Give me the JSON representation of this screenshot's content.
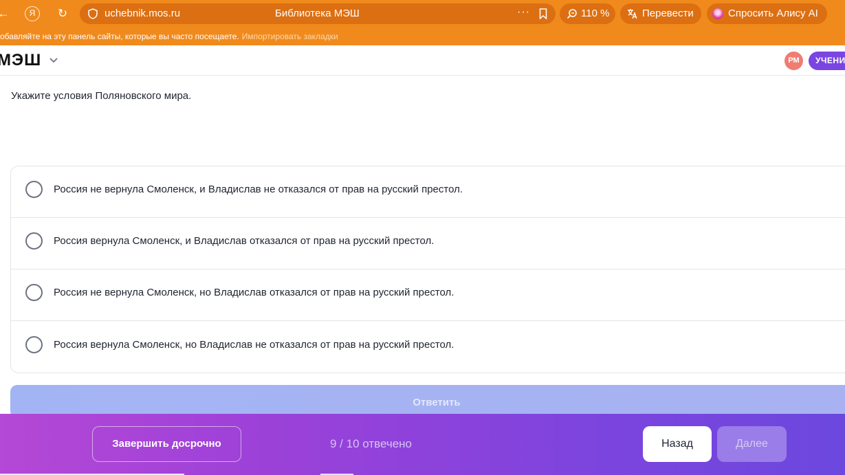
{
  "browser": {
    "url": "uchebnik.mos.ru",
    "tab_title": "Библиотека МЭШ",
    "zoom": "110 %",
    "translate_label": "Перевести",
    "alice_label": "Спросить Алису AI",
    "more_dots": "···",
    "bookmarks_hint": "обавляйте на эту панель сайты, которые вы часто посещаете.",
    "import_bookmarks": "Импортировать закладки",
    "yandex_glyph": "Я",
    "back_glyph": "←",
    "reload_glyph": "↻"
  },
  "header": {
    "logo": "МЭШ",
    "avatar_initials": "РМ",
    "role": "УЧЕНИК"
  },
  "question": {
    "text": "Укажите условия Поляновского мира."
  },
  "options": [
    {
      "label": "Россия не вернула Смоленск, и Владислав не отказался от прав на русский престол."
    },
    {
      "label": "Россия вернула Смоленск, и Владислав отказался от прав на русский престол."
    },
    {
      "label": "Россия не вернула Смоленск, но Владислав отказался от прав на русский престол."
    },
    {
      "label": "Россия вернула Смоленск, но Владислав не отказался от прав на русский престол."
    }
  ],
  "answer_button": "Ответить",
  "footer": {
    "finish_label": "Завершить досрочно",
    "progress": "9 / 10 отвечено",
    "back_label": "Назад",
    "next_label": "Далее"
  },
  "colors": {
    "browser_orange": "#f08a1c",
    "accent_purple": "#7a45e0",
    "answer_disabled": "#a3b4f4"
  }
}
